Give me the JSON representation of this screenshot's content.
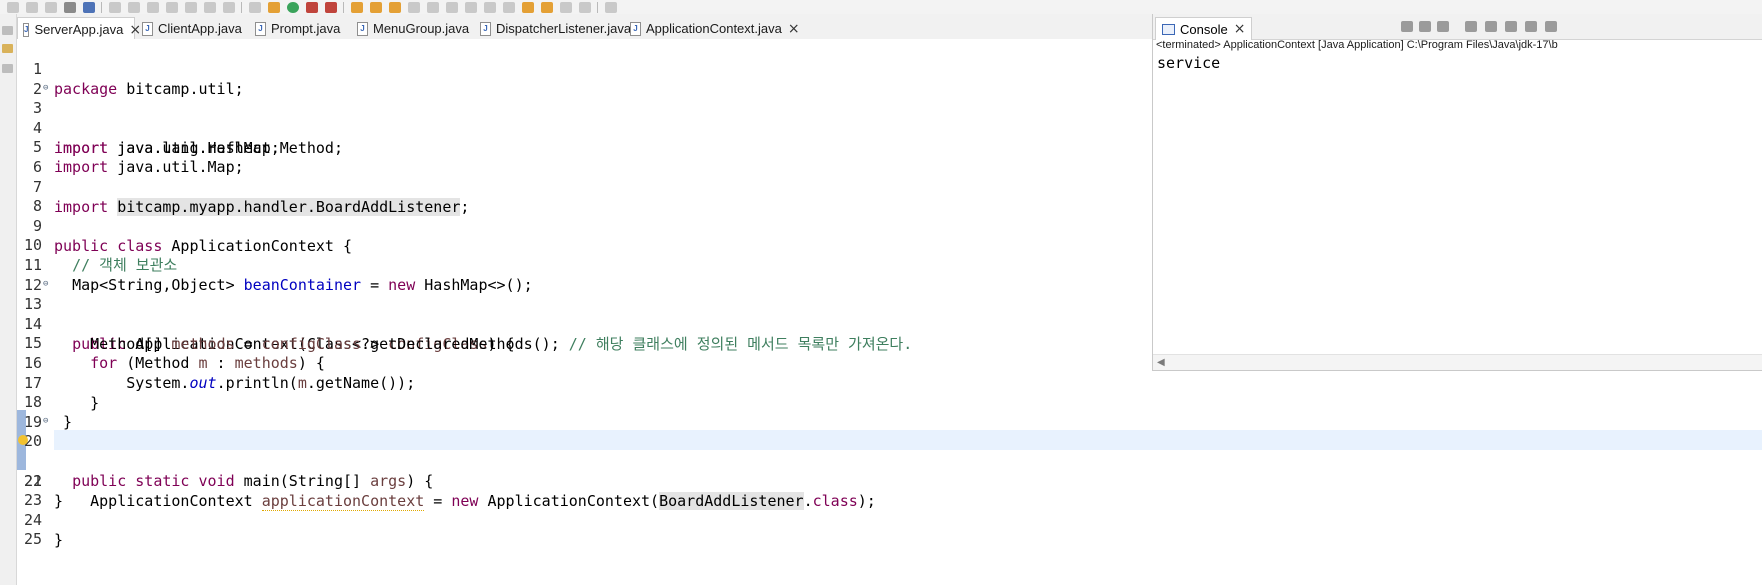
{
  "editor_tabs": [
    {
      "label": "ServerApp.java",
      "active": true,
      "closable": true
    },
    {
      "label": "ClientApp.java",
      "active": false,
      "closable": false
    },
    {
      "label": "Prompt.java",
      "active": false,
      "closable": false
    },
    {
      "label": "MenuGroup.java",
      "active": false,
      "closable": false
    },
    {
      "label": "DispatcherListener.java",
      "active": false,
      "closable": false
    },
    {
      "label": "ApplicationContext.java",
      "active": false,
      "closable": true
    }
  ],
  "code": {
    "line_numbers": [
      "1",
      "2",
      "3",
      "4",
      "5",
      "6",
      "7",
      "8",
      "9",
      "10",
      "11",
      "12",
      "13",
      "14",
      "15",
      "16",
      "17",
      "18",
      "19",
      "20",
      "21",
      "22",
      "23",
      "24",
      "25"
    ],
    "l1": {
      "kw": "package",
      "rest": " bitcamp.util;"
    },
    "l3": {
      "kw": "import",
      "rest": " java.lang.reflect.Method;"
    },
    "l4": {
      "kw": "import",
      "rest": " java.util.HashMap;"
    },
    "l5": {
      "kw": "import",
      "rest": " java.util.Map;"
    },
    "l7": {
      "kw": "import",
      "mark": "bitcamp.myapp.handler.BoardAddListener",
      "rest": ";"
    },
    "l9": {
      "kw": "public class",
      "rest": " ApplicationContext {"
    },
    "l10": {
      "comment": "// 객체 보관소"
    },
    "l11": {
      "pre": "Map<String,Object> ",
      "field": "beanContainer",
      "mid": " = ",
      "kw": "new",
      "rest": " HashMap<>();"
    },
    "l13": {
      "kw": "public",
      "pre": " ApplicationContext(Class<?> ",
      "param": "configClass",
      "rest": ") {"
    },
    "l14": {
      "pre": "Method[] ",
      "var": "methods",
      "mid": " = ",
      "param": "configClass",
      "rest": ".getDeclaredMethods(); ",
      "comment": "// 해당 클래스에 정의된 메서드 목록만 가져온다."
    },
    "l15": {
      "kw": "for",
      "pre": " (Method ",
      "var": "m",
      "mid": " : ",
      "var2": "methods",
      "rest": ") {"
    },
    "l16": {
      "pre": "System.",
      "static": "out",
      "mid": ".println(",
      "var": "m",
      "rest": ".getName());"
    },
    "l17": {
      "text": "}"
    },
    "l18": {
      "text": "}"
    },
    "l20": {
      "kw": "public static void",
      "rest": " main(String[] ",
      "param": "args",
      "end": ") {"
    },
    "l21": {
      "pre": "ApplicationContext ",
      "var": "applicationContext",
      "mid": " = ",
      "kw": "new",
      "rest": " ApplicationContext(",
      "mark": "BoardAddListener",
      "dot": ".",
      "kw2": "class",
      "end": ");"
    },
    "l22": {
      "text": "}"
    },
    "l24": {
      "text": "}"
    }
  },
  "console": {
    "tab_label": "Console",
    "status": "<terminated> ApplicationContext [Java Application] C:\\Program Files\\Java\\jdk-17\\b",
    "output": "service"
  }
}
